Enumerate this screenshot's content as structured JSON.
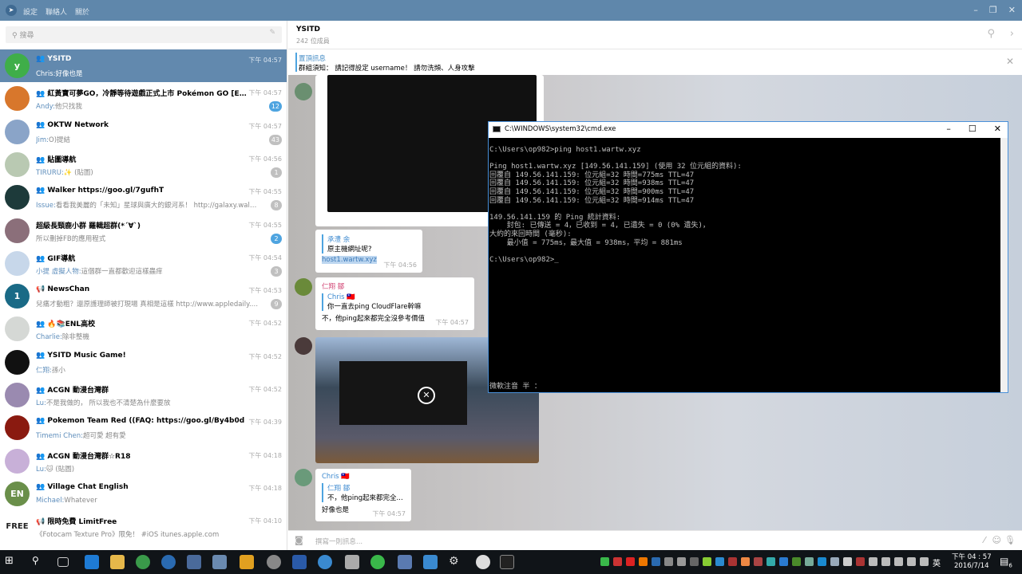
{
  "titlebar": {
    "menu": [
      "設定",
      "聯絡人",
      "關於"
    ]
  },
  "search": {
    "placeholder": "搜尋"
  },
  "chats": [
    {
      "name": "YSITD",
      "time": "下午 04:57",
      "sender": "Chris:",
      "text": "好像也是",
      "badge": "",
      "group": true,
      "active": true,
      "avatar": "y",
      "color": "#3fae49"
    },
    {
      "name": "紅黃寶可夢GO，冷靜等待遊戲正式上市 Pokémon GO [ENL] 本...",
      "time": "下午 04:57",
      "sender": "Andy:",
      "text": "他只找我",
      "badge": "12",
      "blue": true,
      "group": true,
      "avatar": "",
      "color": "#d8772c"
    },
    {
      "name": "OKTW Network",
      "time": "下午 04:57",
      "sender": "Jim:",
      "text": "O)提結",
      "badge": "43",
      "group": true,
      "avatar": "",
      "color": "#8aa4c8"
    },
    {
      "name": "貼圖導航",
      "time": "下午 04:56",
      "sender": "TIRURU:",
      "text": "✨ (貼圖)",
      "badge": "1",
      "group": true,
      "avatar": "",
      "color": "#b9c9b2"
    },
    {
      "name": "Walker https://goo.gl/7gufhT",
      "time": "下午 04:55",
      "sender": "Issue:",
      "text": "看看我美麗的「未知」星球與廣大的銀河系！ http://galaxy.walkrga...",
      "badge": "8",
      "group": true,
      "avatar": "",
      "color": "#1d3a3a"
    },
    {
      "name": "超級長頸鹿小群 羅輯超群(*´∀`)",
      "time": "下午 04:55",
      "sender": "",
      "text": "所以刪掉FB的應用程式",
      "badge": "2",
      "blue": true,
      "group": false,
      "avatar": "",
      "color": "#8b6f7a"
    },
    {
      "name": "GIF導航",
      "time": "下午 04:54",
      "sender": "小提 虛擬人物:",
      "text": "這個群一直都歡迎這樣蟲痒",
      "badge": "3",
      "group": true,
      "avatar": "",
      "color": "#c7d7ea"
    },
    {
      "name": "NewsChan",
      "time": "下午 04:53",
      "sender": "",
      "text": "兒痛才動粗？還原護理師被打現場 真相是這樣 http://www.appledaily.com...",
      "badge": "9",
      "group": false,
      "channel": true,
      "avatar": "1",
      "color": "#1a6a86"
    },
    {
      "name": "🔥📚ENL高校",
      "time": "下午 04:52",
      "sender": "Charlie:",
      "text": "除非整機",
      "badge": "",
      "group": true,
      "avatar": "",
      "color": "#d5d8d5"
    },
    {
      "name": "YSITD Music Game!",
      "time": "下午 04:52",
      "sender": "仁翔:",
      "text": "孫小",
      "badge": "",
      "group": true,
      "avatar": "",
      "color": "#111"
    },
    {
      "name": "ACGN 動漫台灣群",
      "time": "下午 04:52",
      "sender": "Lu:",
      "text": "不是我做的， 所以我也不清楚為什麼要放",
      "badge": "",
      "group": true,
      "avatar": "",
      "color": "#9a8ab0"
    },
    {
      "name": "Pokemon Team Red  ((FAQ: https://goo.gl/By4b0d",
      "time": "下午 04:39",
      "sender": "Timemi Chen:",
      "text": "超可愛 超有愛",
      "badge": "",
      "group": true,
      "avatar": "",
      "color": "#8a1a10"
    },
    {
      "name": "ACGN 動漫台灣群☆R18",
      "time": "下午 04:18",
      "sender": "Lu:",
      "text": "🐱 (貼圖)",
      "badge": "",
      "group": true,
      "avatar": "",
      "color": "#c8b0d8"
    },
    {
      "name": "Village Chat English",
      "time": "下午 04:18",
      "sender": "Michael:",
      "text": "Whatever",
      "badge": "",
      "group": true,
      "avatar": "EN",
      "color": "#6a8f4a"
    },
    {
      "name": "限時免費 LimitFree",
      "time": "下午 04:10",
      "sender": "",
      "text": "《Fotocam Texture Pro》限免！ #iOS itunes.apple.com",
      "badge": "",
      "group": false,
      "channel": true,
      "avatar": "FREE",
      "color": "#ffffff"
    }
  ],
  "chat": {
    "title": "YSITD",
    "members": "242 位成員",
    "pinned_label": "置頂訊息",
    "pinned_text": "群組須知： 請記得設定 username！ 請勿洗頻、人身攻擊",
    "input_placeholder": "撰寫一則訊息..."
  },
  "messages": {
    "m1": {
      "quote_name": "承澧 余",
      "quote_text": "原主機網址呢?",
      "text": "host1.wartw.xyz",
      "time": "下午 04:56"
    },
    "m2": {
      "sender": "仁翔 鄒",
      "quote_name": "Chris 🇹🇼",
      "quote_text": "你一直去ping CloudFlare幹嘛",
      "text": "不，他ping起來都完全沒參考價值",
      "time": "下午 04:57"
    },
    "m3": {
      "sender": "Chris 🇹🇼",
      "quote_name": "仁翔 鄒",
      "quote_text": "不，他ping起來都完全...",
      "text": "好像也是",
      "time": "下午 04:57"
    }
  },
  "cmd": {
    "title": "C:\\WINDOWS\\system32\\cmd.exe",
    "output": "C:\\Users\\op982>ping host1.wartw.xyz\n\nPing host1.wartw.xyz [149.56.141.159] (使用 32 位元組的資料):\n回覆自 149.56.141.159: 位元組=32 時間=775ms TTL=47\n回覆自 149.56.141.159: 位元組=32 時間=938ms TTL=47\n回覆自 149.56.141.159: 位元組=32 時間=900ms TTL=47\n回覆自 149.56.141.159: 位元組=32 時間=914ms TTL=47\n\n149.56.141.159 的 Ping 統計資料:\n    封包: 已傳送 = 4，已收到 = 4, 已遺失 = 0 (0% 遺失)，\n大約的來回時間 (毫秒):\n    最小值 = 775ms，最大值 = 938ms，平均 = 881ms\n\nC:\\Users\\op982>_",
    "ime": "微軟注音 半 ："
  },
  "taskbar": {
    "lang": "英",
    "time": "下午 04 : 57",
    "date": "2016/7/14",
    "notif_count": "6"
  }
}
